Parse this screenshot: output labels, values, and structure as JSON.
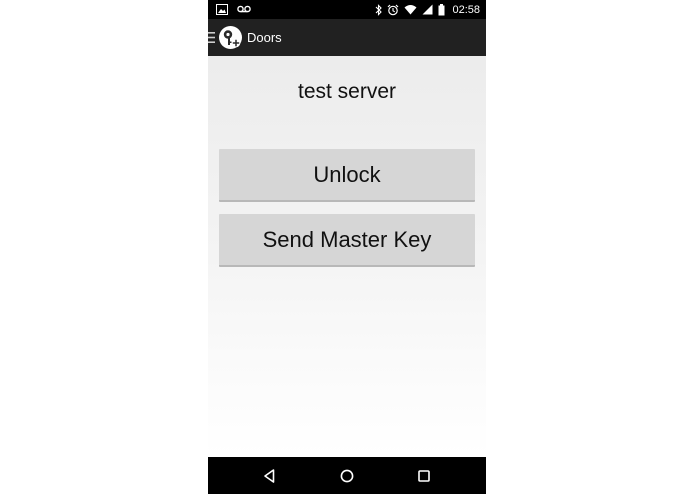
{
  "status_bar": {
    "time": "02:58",
    "icons": [
      "image-notification-icon",
      "voicemail-icon",
      "bluetooth-icon",
      "alarm-icon",
      "wifi-icon",
      "signal-icon",
      "battery-icon"
    ]
  },
  "action_bar": {
    "title": "Doors",
    "icons": [
      "drawer-icon",
      "key-add-logo-icon"
    ]
  },
  "main": {
    "server_name": "test server",
    "unlock_label": "Unlock",
    "master_key_label": "Send Master Key"
  },
  "nav_bar": {
    "icons": [
      "back-icon",
      "home-icon",
      "recents-icon"
    ]
  },
  "colors": {
    "status_bar": "#000000",
    "action_bar": "#212121",
    "button": "#d6d6d6",
    "text": "#111111"
  }
}
